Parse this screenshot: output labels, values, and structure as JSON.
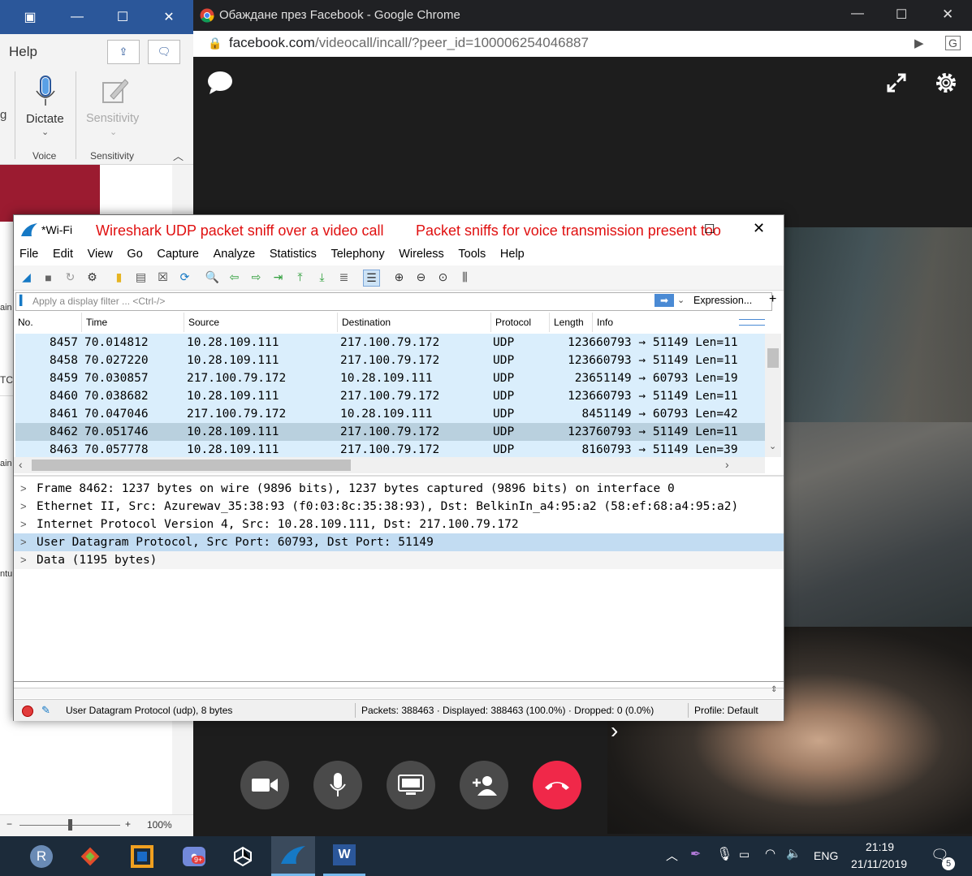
{
  "word": {
    "ribbon_tab": "Help",
    "dictate_label": "Dictate",
    "sensitivity_label": "Sensitivity",
    "group_voice": "Voice",
    "group_sensitivity": "Sensitivity",
    "partial_left_g": "g",
    "partial_left_tc": "TC",
    "partial_left_ai": "ain",
    "partial_left_ntu": "ntu",
    "zoom_level": "100%"
  },
  "chrome": {
    "tab_title": "Обаждане през Facebook - Google Chrome",
    "url_domain": "facebook.com",
    "url_path": "/videocall/incall/?peer_id=100006254046887"
  },
  "wireshark": {
    "window_title": "*Wi-Fi",
    "annotation_left": "Wireshark UDP packet sniff over a video call",
    "annotation_right": "Packet sniffs for voice transmission present too",
    "menu": [
      "File",
      "Edit",
      "View",
      "Go",
      "Capture",
      "Analyze",
      "Statistics",
      "Telephony",
      "Wireless",
      "Tools",
      "Help"
    ],
    "filter_placeholder": "Apply a display filter ... <Ctrl-/>",
    "expression_label": "Expression...",
    "plus_label": "+",
    "columns": [
      "No.",
      "Time",
      "Source",
      "Destination",
      "Protocol",
      "Length",
      "Info"
    ],
    "packets": [
      {
        "no": "8457",
        "time": "70.014812",
        "src": "10.28.109.111",
        "dst": "217.100.79.172",
        "proto": "UDP",
        "len": "1236",
        "info": "60793 → 51149 Len=11"
      },
      {
        "no": "8458",
        "time": "70.027220",
        "src": "10.28.109.111",
        "dst": "217.100.79.172",
        "proto": "UDP",
        "len": "1236",
        "info": "60793 → 51149 Len=11"
      },
      {
        "no": "8459",
        "time": "70.030857",
        "src": "217.100.79.172",
        "dst": "10.28.109.111",
        "proto": "UDP",
        "len": "236",
        "info": "51149 → 60793 Len=19"
      },
      {
        "no": "8460",
        "time": "70.038682",
        "src": "10.28.109.111",
        "dst": "217.100.79.172",
        "proto": "UDP",
        "len": "1236",
        "info": "60793 → 51149 Len=11"
      },
      {
        "no": "8461",
        "time": "70.047046",
        "src": "217.100.79.172",
        "dst": "10.28.109.111",
        "proto": "UDP",
        "len": "84",
        "info": "51149 → 60793 Len=42"
      },
      {
        "no": "8462",
        "time": "70.051746",
        "src": "10.28.109.111",
        "dst": "217.100.79.172",
        "proto": "UDP",
        "len": "1237",
        "info": "60793 → 51149 Len=11"
      },
      {
        "no": "8463",
        "time": "70.057778",
        "src": "10.28.109.111",
        "dst": "217.100.79.172",
        "proto": "UDP",
        "len": "81",
        "info": "60793 → 51149 Len=39"
      }
    ],
    "details": [
      "Frame 8462: 1237 bytes on wire (9896 bits), 1237 bytes captured (9896 bits) on interface 0",
      "Ethernet II, Src: Azurewav_35:38:93 (f0:03:8c:35:38:93), Dst: BelkinIn_a4:95:a2 (58:ef:68:a4:95:a2)",
      "Internet Protocol Version 4, Src: 10.28.109.111, Dst: 217.100.79.172",
      "User Datagram Protocol, Src Port: 60793, Dst Port: 51149",
      "Data (1195 bytes)"
    ],
    "status_field": "User Datagram Protocol (udp), 8 bytes",
    "status_packets": "Packets: 388463 · Displayed: 388463 (100.0%) · Dropped: 0 (0.0%)",
    "status_profile": "Profile: Default"
  },
  "taskbar": {
    "lang": "ENG",
    "time": "21:19",
    "date": "21/11/2019",
    "notif_count": "5",
    "discord_badge": "9+"
  },
  "colors": {
    "annotation_red": "#e01010",
    "row_blue": "#daeefc",
    "row_selected": "#b9d0de",
    "end_call": "#f02849"
  }
}
